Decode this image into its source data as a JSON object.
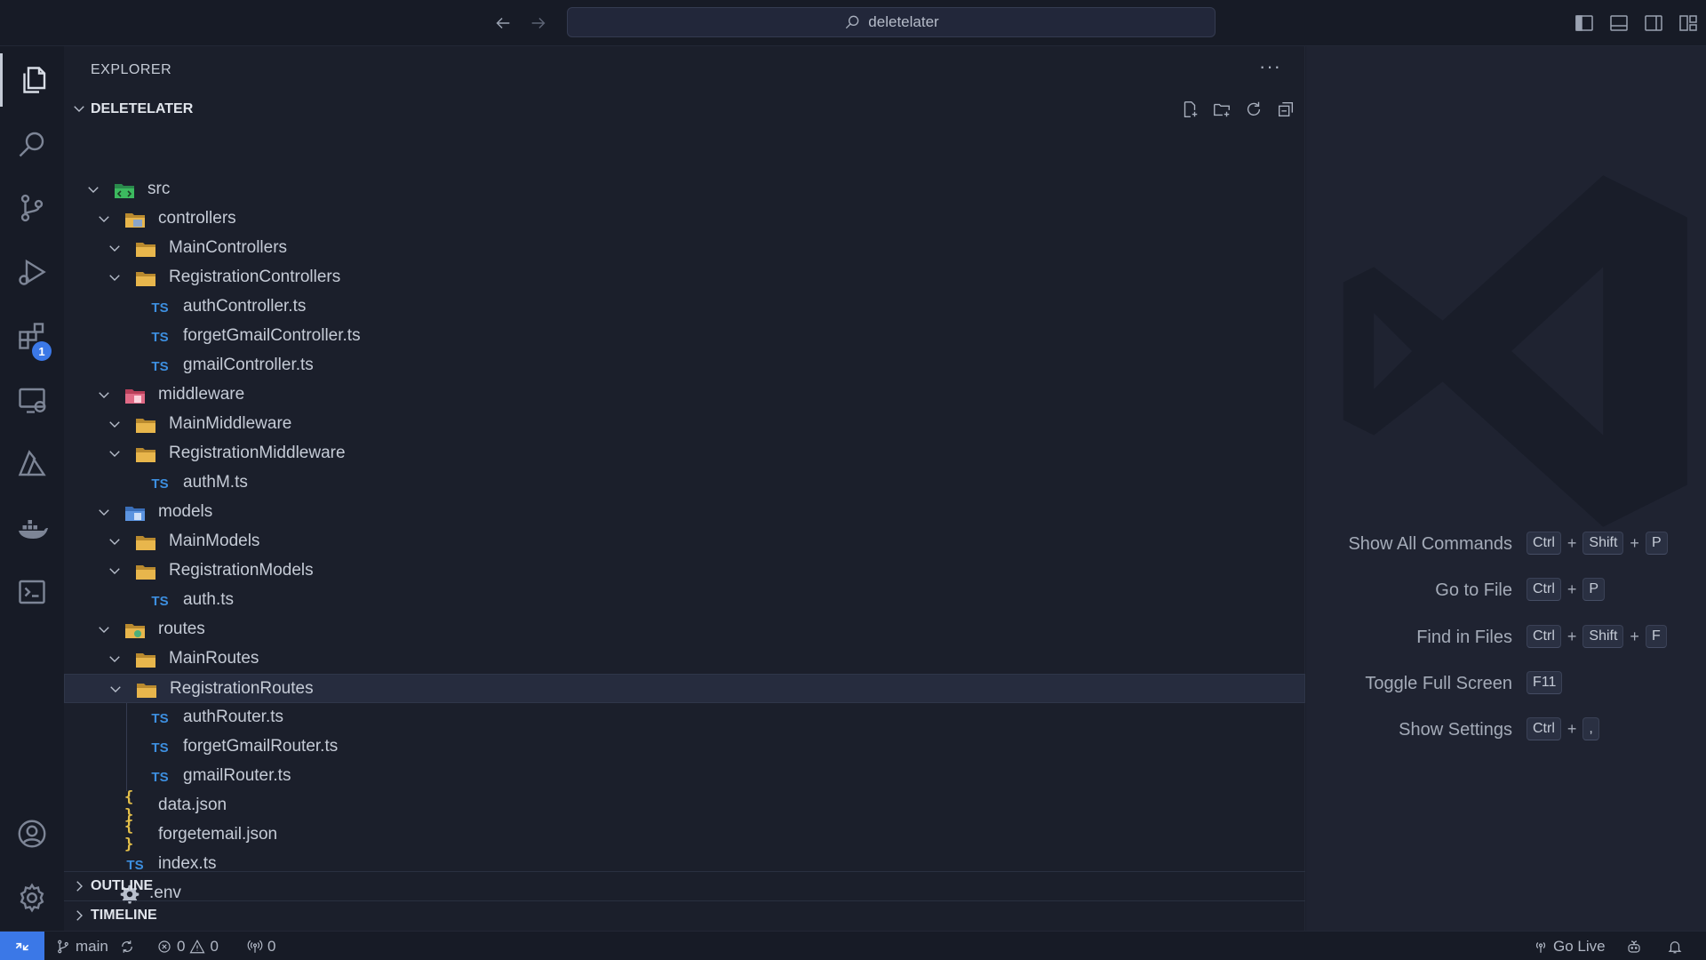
{
  "titlebar": {
    "search_text": "deletelater",
    "icons": [
      "back-arrow-icon",
      "forward-arrow-icon",
      "search-icon",
      "toggle-primary-sidebar-icon",
      "toggle-panel-icon",
      "toggle-secondary-sidebar-icon",
      "customize-layout-icon"
    ]
  },
  "activity_bar": {
    "items": [
      "explorer",
      "search",
      "source-control",
      "run-and-debug",
      "extensions",
      "remote-explorer",
      "azure",
      "docker",
      "terminal",
      "accounts",
      "manage"
    ],
    "extensions_badge": "1"
  },
  "explorer": {
    "title": "EXPLORER",
    "more": "···",
    "root": "DELETELATER",
    "tree": [
      {
        "label": "src",
        "depth": 0,
        "kind": "folder-src",
        "expanded": true
      },
      {
        "label": "controllers",
        "depth": 1,
        "kind": "folder-controllers",
        "expanded": true
      },
      {
        "label": "MainControllers",
        "depth": 2,
        "kind": "folder",
        "expanded": true
      },
      {
        "label": "RegistrationControllers",
        "depth": 2,
        "kind": "folder",
        "expanded": true
      },
      {
        "label": "authController.ts",
        "depth": 3,
        "kind": "ts"
      },
      {
        "label": "forgetGmailController.ts",
        "depth": 3,
        "kind": "ts"
      },
      {
        "label": "gmailController.ts",
        "depth": 3,
        "kind": "ts"
      },
      {
        "label": "middleware",
        "depth": 1,
        "kind": "folder-middleware",
        "expanded": true
      },
      {
        "label": "MainMiddleware",
        "depth": 2,
        "kind": "folder",
        "expanded": true
      },
      {
        "label": "RegistrationMiddleware",
        "depth": 2,
        "kind": "folder",
        "expanded": true
      },
      {
        "label": "authM.ts",
        "depth": 3,
        "kind": "ts"
      },
      {
        "label": "models",
        "depth": 1,
        "kind": "folder-models",
        "expanded": true
      },
      {
        "label": "MainModels",
        "depth": 2,
        "kind": "folder",
        "expanded": true
      },
      {
        "label": "RegistrationModels",
        "depth": 2,
        "kind": "folder",
        "expanded": true
      },
      {
        "label": "auth.ts",
        "depth": 3,
        "kind": "ts"
      },
      {
        "label": "routes",
        "depth": 1,
        "kind": "folder-routes",
        "expanded": true
      },
      {
        "label": "MainRoutes",
        "depth": 2,
        "kind": "folder",
        "expanded": true
      },
      {
        "label": "RegistrationRoutes",
        "depth": 2,
        "kind": "folder",
        "expanded": true,
        "selected": true
      },
      {
        "label": "authRouter.ts",
        "depth": 3,
        "kind": "ts"
      },
      {
        "label": "forgetGmailRouter.ts",
        "depth": 3,
        "kind": "ts"
      },
      {
        "label": "gmailRouter.ts",
        "depth": 3,
        "kind": "ts"
      },
      {
        "label": "data.json",
        "depth": 1,
        "kind": "json"
      },
      {
        "label": "forgetemail.json",
        "depth": 1,
        "kind": "json"
      },
      {
        "label": "index.ts",
        "depth": 1,
        "kind": "ts"
      },
      {
        "label": ".env",
        "depth": 0,
        "kind": "env"
      }
    ],
    "ts_badge": "TS",
    "json_badge": "{ }",
    "sections": [
      "OUTLINE",
      "TIMELINE"
    ]
  },
  "editor": {
    "shortcuts": [
      {
        "label": "Show All Commands",
        "keys": [
          "Ctrl",
          "Shift",
          "P"
        ]
      },
      {
        "label": "Go to File",
        "keys": [
          "Ctrl",
          "P"
        ]
      },
      {
        "label": "Find in Files",
        "keys": [
          "Ctrl",
          "Shift",
          "F"
        ]
      },
      {
        "label": "Toggle Full Screen",
        "keys": [
          "F11"
        ]
      },
      {
        "label": "Show Settings",
        "keys": [
          "Ctrl",
          ","
        ]
      }
    ]
  },
  "statusbar": {
    "branch": "main",
    "errors": "0",
    "warnings": "0",
    "ports": "0",
    "go_live": "Go Live"
  },
  "colors": {
    "accent": "#3b78e7",
    "ts": "#3d8fe0",
    "json": "#e5c04a",
    "folder": "#e8b64c"
  }
}
